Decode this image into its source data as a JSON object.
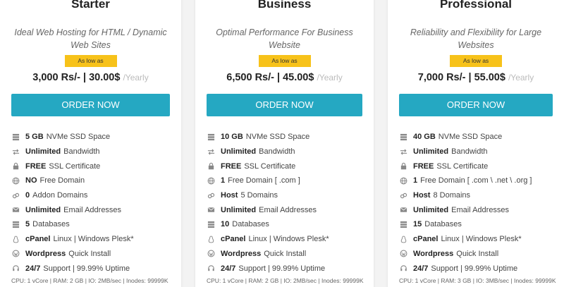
{
  "plans": [
    {
      "name": "Starter",
      "tagline": "Ideal Web Hosting for HTML / Dynamic Web Sites",
      "badge": "As low as",
      "price": "3,000 Rs/- | 30.00$",
      "period": "/Yearly",
      "button": "ORDER NOW",
      "features": [
        {
          "icon": "database-icon",
          "bold": "5 GB",
          "text": "NVMe SSD Space"
        },
        {
          "icon": "transfer-icon",
          "bold": "Unlimited",
          "text": "Bandwidth"
        },
        {
          "icon": "lock-icon",
          "bold": "FREE",
          "text": "SSL Certificate"
        },
        {
          "icon": "globe-icon",
          "bold": "NO",
          "text": "Free Domain"
        },
        {
          "icon": "link-icon",
          "bold": "0",
          "text": "Addon Domains"
        },
        {
          "icon": "mail-icon",
          "bold": "Unlimited",
          "text": "Email Addresses"
        },
        {
          "icon": "db-icon",
          "bold": "5",
          "text": "Databases"
        },
        {
          "icon": "linux-icon",
          "bold": "cPanel",
          "text": "Linux | Windows Plesk*"
        },
        {
          "icon": "wordpress-icon",
          "bold": "Wordpress",
          "text": "Quick Install"
        },
        {
          "icon": "headset-icon",
          "bold": "24/7",
          "text": "Support | 99.99% Uptime"
        }
      ],
      "specs": "CPU: 1 vCore | RAM: 2 GB | IO: 2MB/sec | Inodes: 99999K"
    },
    {
      "name": "Business",
      "tagline": "Optimal Performance For Business Website",
      "badge": "As low as",
      "price": "6,500 Rs/- | 45.00$",
      "period": "/Yearly",
      "button": "ORDER NOW",
      "features": [
        {
          "icon": "database-icon",
          "bold": "10 GB",
          "text": "NVMe SSD Space"
        },
        {
          "icon": "transfer-icon",
          "bold": "Unlimited",
          "text": "Bandwidth"
        },
        {
          "icon": "lock-icon",
          "bold": "FREE",
          "text": "SSL Certificate"
        },
        {
          "icon": "globe-icon",
          "bold": "1",
          "text": "Free Domain [ .com ]"
        },
        {
          "icon": "link-icon",
          "bold": "Host",
          "text": "5 Domains"
        },
        {
          "icon": "mail-icon",
          "bold": "Unlimited",
          "text": "Email Addresses"
        },
        {
          "icon": "db-icon",
          "bold": "10",
          "text": "Databases"
        },
        {
          "icon": "linux-icon",
          "bold": "cPanel",
          "text": "Linux | Windows Plesk*"
        },
        {
          "icon": "wordpress-icon",
          "bold": "Wordpress",
          "text": "Quick Install"
        },
        {
          "icon": "headset-icon",
          "bold": "24/7",
          "text": "Support | 99.99% Uptime"
        }
      ],
      "specs": "CPU: 1 vCore | RAM: 2 GB | IO: 2MB/sec | Inodes: 99999K"
    },
    {
      "name": "Professional",
      "tagline": "Reliability and Flexibility for Large Websites",
      "badge": "As low as",
      "price": "7,000 Rs/- | 55.00$",
      "period": "/Yearly",
      "button": "ORDER NOW",
      "features": [
        {
          "icon": "database-icon",
          "bold": "40 GB",
          "text": "NVMe SSD Space"
        },
        {
          "icon": "transfer-icon",
          "bold": "Unlimited",
          "text": "Bandwidth"
        },
        {
          "icon": "lock-icon",
          "bold": "FREE",
          "text": "SSL Certificate"
        },
        {
          "icon": "globe-icon",
          "bold": "1",
          "text": "Free Domain [ .com \\ .net \\ .org ]"
        },
        {
          "icon": "link-icon",
          "bold": "Host",
          "text": "8 Domains"
        },
        {
          "icon": "mail-icon",
          "bold": "Unlimited",
          "text": "Email Addresses"
        },
        {
          "icon": "db-icon",
          "bold": "15",
          "text": "Databases"
        },
        {
          "icon": "linux-icon",
          "bold": "cPanel",
          "text": "Linux | Windows Plesk*"
        },
        {
          "icon": "wordpress-icon",
          "bold": "Wordpress",
          "text": "Quick Install"
        },
        {
          "icon": "headset-icon",
          "bold": "24/7",
          "text": "Support | 99.99% Uptime"
        }
      ],
      "specs": "CPU: 1 vCore | RAM: 3 GB | IO: 3MB/sec | Inodes: 99999K"
    }
  ],
  "colors": {
    "accent": "#25a8c2",
    "badge": "#f7c21a",
    "background": "#f3f3f3",
    "card": "#ffffff"
  }
}
